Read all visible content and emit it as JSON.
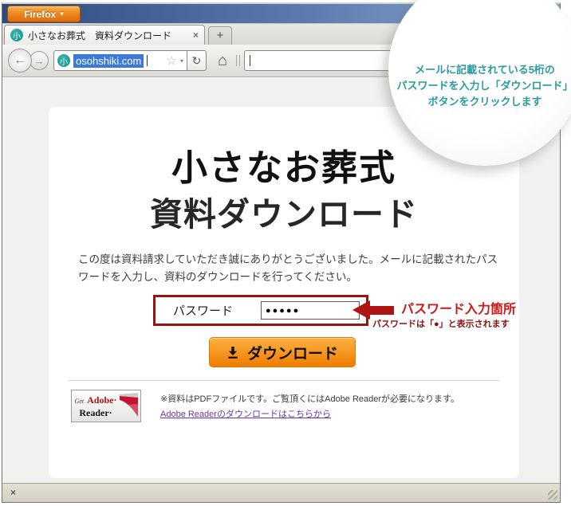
{
  "browser": {
    "firefox_button_label": "Firefox",
    "tab_title": "小さなお葬式　資料ダウンロード",
    "url_text": "osohshiki.com",
    "favicon_char": "小"
  },
  "icons": {
    "menu_caret": "▾",
    "tab_close": "×",
    "new_tab": "+",
    "back": "←",
    "forward": "→",
    "star": "☆",
    "url_caret": "▾",
    "reload": "↻",
    "home": "⌂",
    "addon_close": "×"
  },
  "callout": {
    "lines": [
      "メールに記載されている5桁の",
      "パスワードを入力し「ダウンロード」",
      "ボタンをクリックします"
    ]
  },
  "page": {
    "title_line1": "小さなお葬式",
    "title_line2": "資料ダウンロード",
    "intro": "この度は資料請求していただき誠にありがとうございました。メールに記載されたパスワードを入力し、資料のダウンロードを行ってください。",
    "password_label": "パスワード",
    "password_value": "●●●●●",
    "annotation_title": "パスワード入力箇所",
    "annotation_note": "パスワードは「●」と表示されます",
    "download_button_label": "ダウンロード",
    "adobe_badge_get": "Get",
    "adobe_badge_adobe": "Adobe·",
    "adobe_badge_reader": "Reader·",
    "adobe_note": "※資料はPDFファイルです。ご覧頂くにはAdobe Readerが必要になります。",
    "adobe_link": "Adobe Readerのダウンロードはこちらから"
  },
  "colors": {
    "firefox_orange": "#f08a1d",
    "titlebar_blue_left": "#2c4b7e",
    "titlebar_blue_right": "#91abd1",
    "callout_teal": "#2a9b9c",
    "annotation_red": "#cf1717",
    "box_maroon": "#971414",
    "button_orange": "#f5941d",
    "link_purple": "#6a35a8",
    "favicon_teal": "#158f8a"
  }
}
